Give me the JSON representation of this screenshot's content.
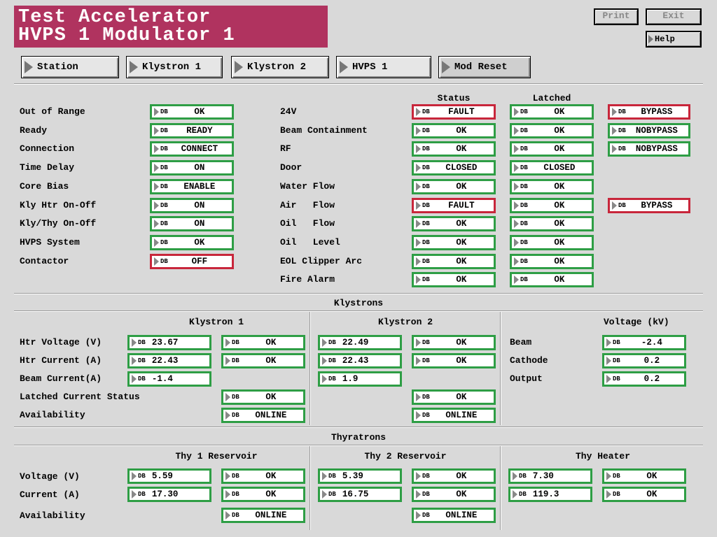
{
  "title": {
    "line1": "Test Accelerator",
    "line2": "HVPS 1 Modulator 1"
  },
  "window_buttons": {
    "print": "Print",
    "exit": "Exit",
    "help": "Help"
  },
  "nav": {
    "station": "Station",
    "klystron1": "Klystron 1",
    "klystron2": "Klystron 2",
    "hvps1": "HVPS 1",
    "mod_reset": "Mod Reset"
  },
  "db_tag": "DB",
  "colors": {
    "title_bg": "#b0335f",
    "ok_border": "#2e9e45",
    "fault_border": "#c8263b",
    "panel_bg": "#d9d9d9"
  },
  "status": {
    "col_status": "Status",
    "col_latched": "Latched",
    "left": [
      {
        "label": "Out of Range",
        "value": "OK",
        "state": "ok"
      },
      {
        "label": "Ready",
        "value": "READY",
        "state": "ok"
      },
      {
        "label": "Connection",
        "value": "CONNECT",
        "state": "ok"
      },
      {
        "label": "Time Delay",
        "value": "ON",
        "state": "ok"
      },
      {
        "label": "Core Bias",
        "value": "ENABLE",
        "state": "ok"
      },
      {
        "label": "Kly Htr On-Off",
        "value": "ON",
        "state": "ok"
      },
      {
        "label": "Kly/Thy On-Off",
        "value": "ON",
        "state": "ok"
      },
      {
        "label": "HVPS System",
        "value": "OK",
        "state": "ok"
      },
      {
        "label": "Contactor",
        "value": "OFF",
        "state": "fault"
      }
    ],
    "right": [
      {
        "label": "24V",
        "status": "FAULT",
        "status_state": "fault",
        "latched": "OK",
        "latched_state": "ok",
        "bypass": "BYPASS",
        "bypass_state": "fault"
      },
      {
        "label": "Beam Containment",
        "status": "OK",
        "status_state": "ok",
        "latched": "OK",
        "latched_state": "ok",
        "bypass": "NOBYPASS",
        "bypass_state": "ok"
      },
      {
        "label": "RF",
        "status": "OK",
        "status_state": "ok",
        "latched": "OK",
        "latched_state": "ok",
        "bypass": "NOBYPASS",
        "bypass_state": "ok"
      },
      {
        "label": "Door",
        "status": "CLOSED",
        "status_state": "ok",
        "latched": "CLOSED",
        "latched_state": "ok",
        "bypass": null
      },
      {
        "label": "Water Flow",
        "status": "OK",
        "status_state": "ok",
        "latched": "OK",
        "latched_state": "ok",
        "bypass": null
      },
      {
        "label": "Air   Flow",
        "status": "FAULT",
        "status_state": "fault",
        "latched": "OK",
        "latched_state": "ok",
        "bypass": "BYPASS",
        "bypass_state": "fault"
      },
      {
        "label": "Oil   Flow",
        "status": "OK",
        "status_state": "ok",
        "latched": "OK",
        "latched_state": "ok",
        "bypass": null
      },
      {
        "label": "Oil   Level",
        "status": "OK",
        "status_state": "ok",
        "latched": "OK",
        "latched_state": "ok",
        "bypass": null
      },
      {
        "label": "EOL Clipper Arc",
        "status": "OK",
        "status_state": "ok",
        "latched": "OK",
        "latched_state": "ok",
        "bypass": null
      },
      {
        "label": "Fire Alarm",
        "status": "OK",
        "status_state": "ok",
        "latched": "OK",
        "latched_state": "ok",
        "bypass": null
      }
    ]
  },
  "klystrons": {
    "section_title": "Klystrons",
    "k1_title": "Klystron 1",
    "k2_title": "Klystron 2",
    "volt_title": "Voltage (kV)",
    "row_labels": {
      "htr_voltage": "Htr Voltage (V)",
      "htr_current": "Htr Current (A)",
      "beam_current": "Beam Current(A)",
      "latched": "Latched Current Status",
      "availability": "Availability"
    },
    "k1": {
      "htr_voltage": "23.67",
      "htr_voltage_status": "OK",
      "htr_current": "22.43",
      "htr_current_status": "OK",
      "beam_current": "-1.4",
      "latched": "OK",
      "availability": "ONLINE"
    },
    "k2": {
      "htr_voltage": "22.49",
      "htr_voltage_status": "OK",
      "htr_current": "22.43",
      "htr_current_status": "OK",
      "beam_current": "1.9",
      "latched": "OK",
      "availability": "ONLINE"
    },
    "voltages": [
      {
        "label": "Beam",
        "value": "-2.4"
      },
      {
        "label": "Cathode",
        "value": "0.2"
      },
      {
        "label": "Output",
        "value": "0.2"
      }
    ]
  },
  "thyratrons": {
    "section_title": "Thyratrons",
    "t1_title": "Thy 1 Reservoir",
    "t2_title": "Thy 2 Reservoir",
    "heater_title": "Thy Heater",
    "row_labels": {
      "voltage": "Voltage (V)",
      "current": "Current (A)",
      "availability": "Availability"
    },
    "t1": {
      "voltage": "5.59",
      "voltage_status": "OK",
      "current": "17.30",
      "current_status": "OK",
      "availability": "ONLINE"
    },
    "t2": {
      "voltage": "5.39",
      "voltage_status": "OK",
      "current": "16.75",
      "current_status": "OK",
      "availability": "ONLINE"
    },
    "heater": {
      "voltage": "7.30",
      "voltage_status": "OK",
      "current": "119.3",
      "current_status": "OK"
    }
  }
}
